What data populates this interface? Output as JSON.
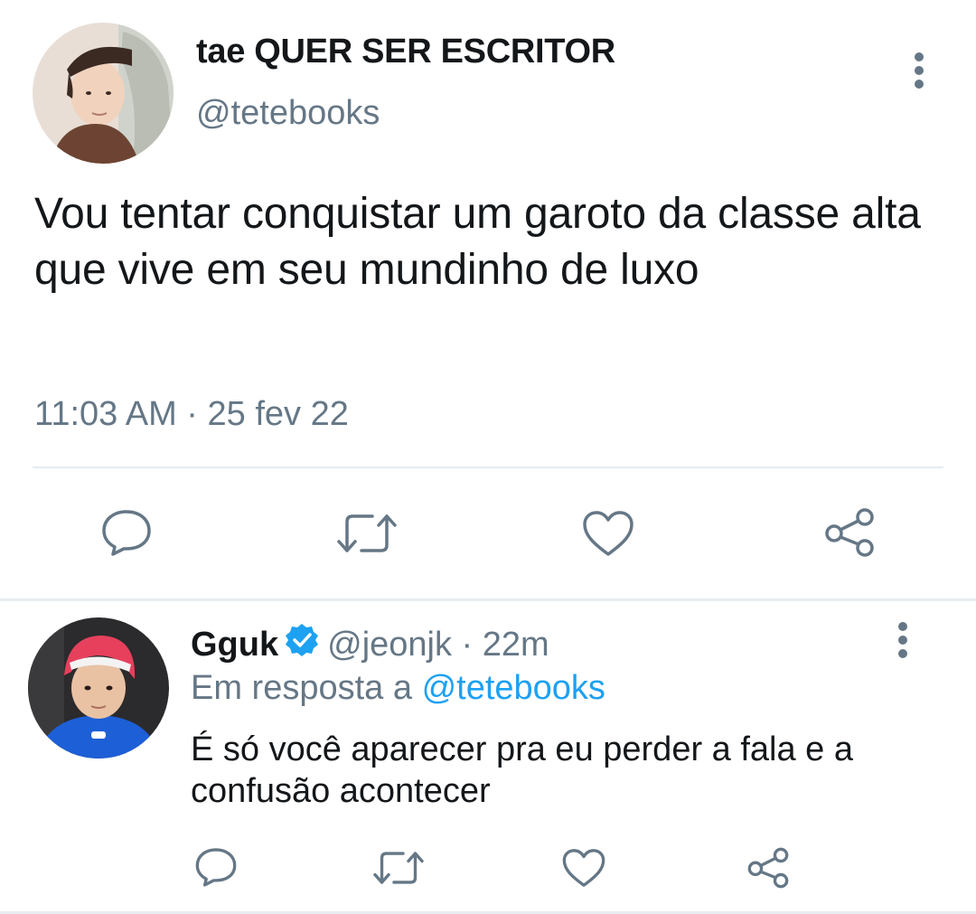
{
  "main_tweet": {
    "display_name": "tae QUER SER ESCRITOR",
    "handle": "@tetebooks",
    "text": "Vou tentar conquistar um garoto da classe alta que vive em seu mundinho de luxo",
    "timestamp": "11:03 AM · 25 fev 22",
    "actions": [
      "reply-icon",
      "retweet-icon",
      "like-icon",
      "share-icon"
    ]
  },
  "reply_tweet": {
    "display_name": "Gguk",
    "verified": true,
    "handle": "@jeonjk",
    "separator": " · ",
    "age": "22m",
    "replying_to_prefix": "Em resposta a ",
    "replying_to_handle": "@tetebooks",
    "text": "É só você aparecer pra eu perder a fala e a confusão acontecer",
    "actions": [
      "reply-icon",
      "retweet-icon",
      "like-icon",
      "share-icon"
    ]
  },
  "colors": {
    "text_primary": "#14171a",
    "text_secondary": "#657786",
    "link": "#1da1f2",
    "verified_badge": "#1da1f2",
    "icon": "#657786",
    "divider": "#e6ecf0"
  }
}
